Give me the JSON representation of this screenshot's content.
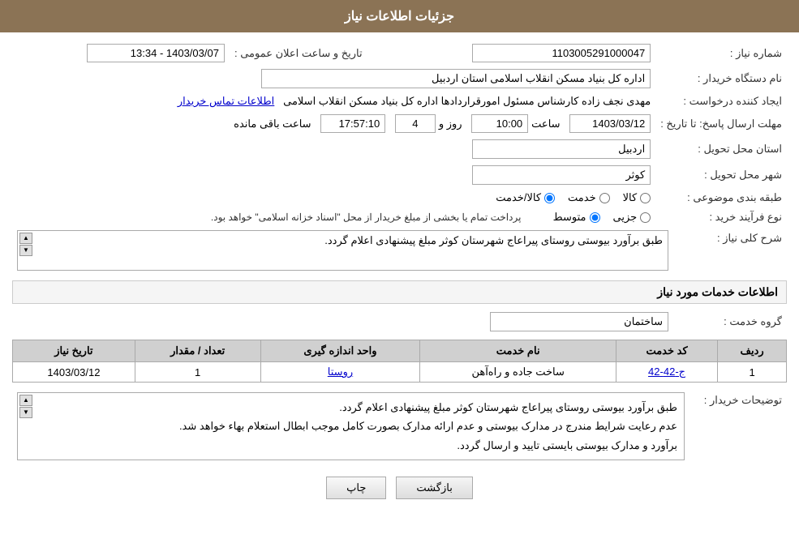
{
  "header": {
    "title": "جزئیات اطلاعات نیاز"
  },
  "fields": {
    "need_number_label": "شماره نیاز :",
    "need_number_value": "1103005291000047",
    "announce_datetime_label": "تاریخ و ساعت اعلان عمومی :",
    "announce_datetime_value": "1403/03/07 - 13:34",
    "buyer_org_label": "نام دستگاه خریدار :",
    "buyer_org_value": "اداره کل بنیاد مسکن انقلاب اسلامی استان اردبیل",
    "requester_label": "ایجاد کننده درخواست :",
    "requester_value": "مهدی نجف زاده کارشناس مسئول امورقراردادها اداره کل بنیاد مسکن انقلاب اسلامی",
    "requester_link": "اطلاعات تماس خریدار",
    "response_deadline_label": "مهلت ارسال پاسخ: تا تاریخ :",
    "response_date": "1403/03/12",
    "response_time_label": "ساعت",
    "response_time": "10:00",
    "response_days_label": "روز و",
    "response_days": "4",
    "response_remaining_label": "ساعت باقی مانده",
    "response_remaining": "17:57:10",
    "delivery_province_label": "استان محل تحویل :",
    "delivery_province_value": "اردبیل",
    "delivery_city_label": "شهر محل تحویل :",
    "delivery_city_value": "کوثر",
    "category_label": "طبقه بندی موضوعی :",
    "category_options": [
      "کالا",
      "خدمت",
      "کالا/خدمت"
    ],
    "category_selected": "کالا",
    "purchase_type_label": "نوع فرآیند خرید :",
    "purchase_type_options": [
      "جزیی",
      "متوسط"
    ],
    "purchase_type_note": "پرداخت تمام یا بخشی از مبلغ خریدار از محل \"اسناد خزانه اسلامی\" خواهد بود.",
    "description_label": "شرح کلی نیاز :",
    "description_value": "طبق برآورد بیوستی روستای پیراعاج شهرستان کوثر مبلغ پیشنهادی اعلام گردد.",
    "services_section_label": "اطلاعات خدمات مورد نیاز",
    "service_group_label": "گروه خدمت :",
    "service_group_value": "ساختمان",
    "table": {
      "headers": [
        "ردیف",
        "کد خدمت",
        "نام خدمت",
        "واحد اندازه گیری",
        "تعداد / مقدار",
        "تاریخ نیاز"
      ],
      "rows": [
        {
          "row": "1",
          "code": "ج-42-42",
          "service": "ساخت جاده و راه‌آهن",
          "unit": "روستا",
          "quantity": "1",
          "date": "1403/03/12"
        }
      ]
    },
    "buyer_notes_label": "توضیحات خریدار :",
    "buyer_notes_lines": [
      "طبق برآورد بیوستی روستای پیراعاج شهرستان کوثر مبلغ پیشنهادی اعلام گردد.",
      "عدم رعایت شرایط مندرج در مدارک بیوستی و عدم ارائه مدارک بصورت کامل موجب ابطال استعلام بهاء خواهد شد.",
      "برآورد و مدارک بیوستی بایستی تایید و ارسال گردد."
    ]
  },
  "buttons": {
    "back": "بازگشت",
    "print": "چاپ"
  }
}
